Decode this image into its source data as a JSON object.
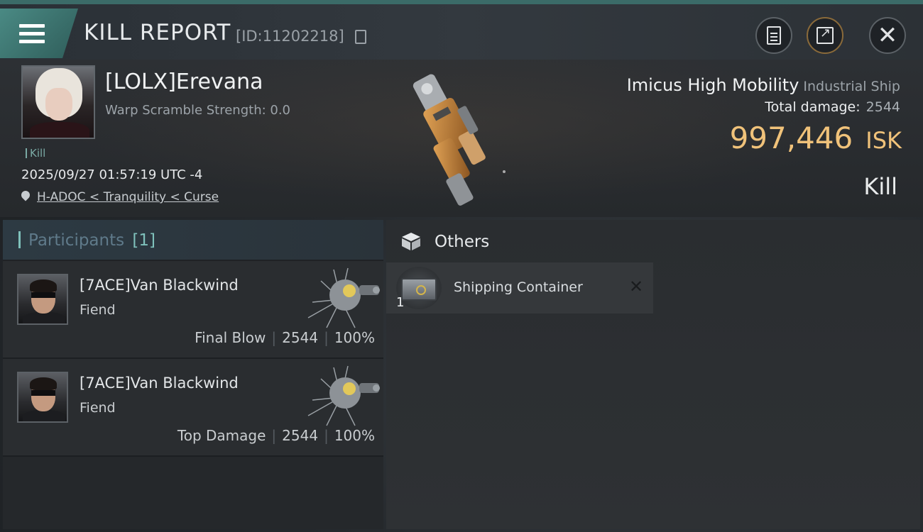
{
  "header": {
    "title": "KILL REPORT",
    "report_id": "[ID:11202218]"
  },
  "victim": {
    "name": "[LOLX]Erevana",
    "warp_scramble": "Warp Scramble Strength: 0.0",
    "tag": "Kill",
    "timestamp": "2025/09/27 01:57:19 UTC -4",
    "location": "H-ADOC < Tranquility < Curse",
    "ship_name": "Imicus High Mobility",
    "ship_class": "Industrial Ship",
    "total_damage_label": "Total damage:",
    "total_damage": "2544",
    "isk_value": "997,446",
    "isk_unit": "ISK",
    "result": "Kill"
  },
  "participants": {
    "title": "Participants",
    "count": "[1]",
    "rows": [
      {
        "name": "[7ACE]Van Blackwind",
        "ship": "Fiend",
        "label": "Final Blow",
        "damage": "2544",
        "percent": "100%"
      },
      {
        "name": "[7ACE]Van Blackwind",
        "ship": "Fiend",
        "label": "Top Damage",
        "damage": "2544",
        "percent": "100%"
      }
    ]
  },
  "others": {
    "title": "Others",
    "items": [
      {
        "name": "Shipping Container",
        "quantity": "1"
      }
    ]
  },
  "icons": [
    "menu-icon",
    "copy-icon",
    "clipboard-icon",
    "share-icon",
    "close-icon",
    "location-pin-icon",
    "box-icon",
    "destroyed-icon"
  ],
  "colors": {
    "accent": "#7fc1bb",
    "isk": "#f0c27a",
    "header_bar": "#3b6b68"
  }
}
